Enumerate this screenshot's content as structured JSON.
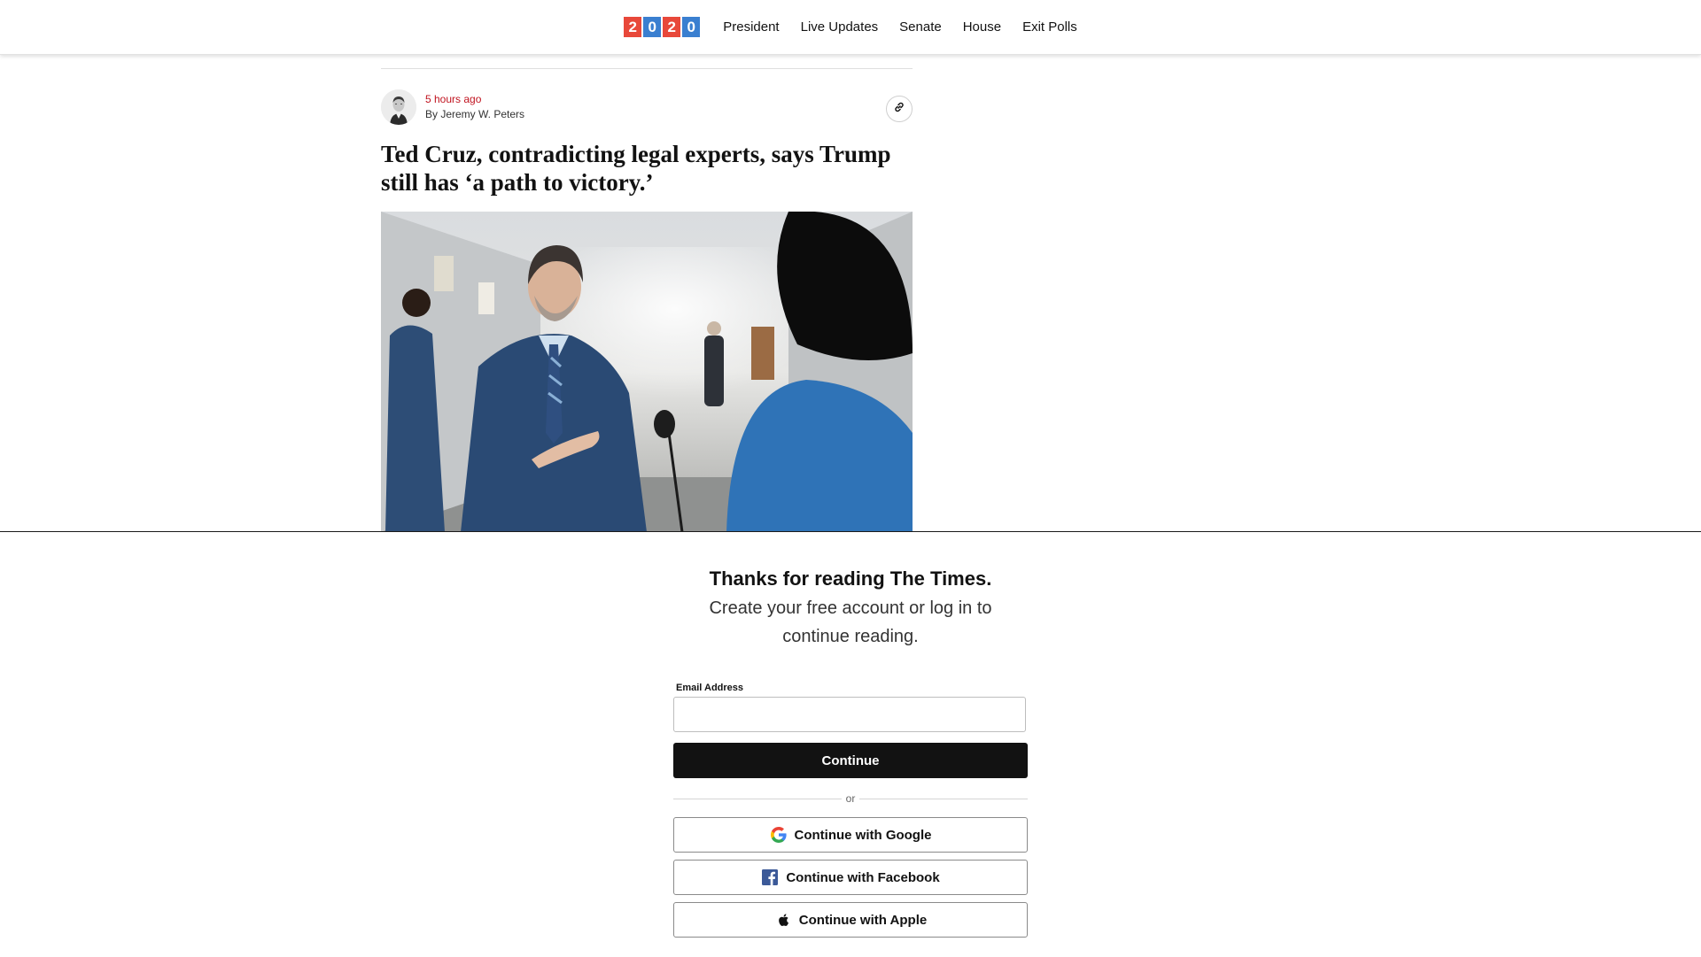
{
  "nav": {
    "logo_digits": [
      "2",
      "0",
      "2",
      "0"
    ],
    "logo_colors": [
      "#e8483a",
      "#3a7fd0",
      "#e8483a",
      "#3a7fd0"
    ],
    "links": [
      "President",
      "Live Updates",
      "Senate",
      "House",
      "Exit Polls"
    ]
  },
  "article": {
    "timestamp": "5 hours ago",
    "byline": "By Jeremy W. Peters",
    "headline": "Ted Cruz, contradicting legal experts, says Trump still has ‘a path to victory.’",
    "link_icon": "link-icon",
    "accent_color": "#c0131f"
  },
  "gate": {
    "title": "Thanks for reading The Times.",
    "subtitle": "Create your free account or log in to continue reading.",
    "email_label": "Email Address",
    "email_value": "",
    "continue_label": "Continue",
    "divider_label": "or",
    "google_label": "Continue with Google",
    "facebook_label": "Continue with Facebook",
    "apple_label": "Continue with Apple"
  }
}
